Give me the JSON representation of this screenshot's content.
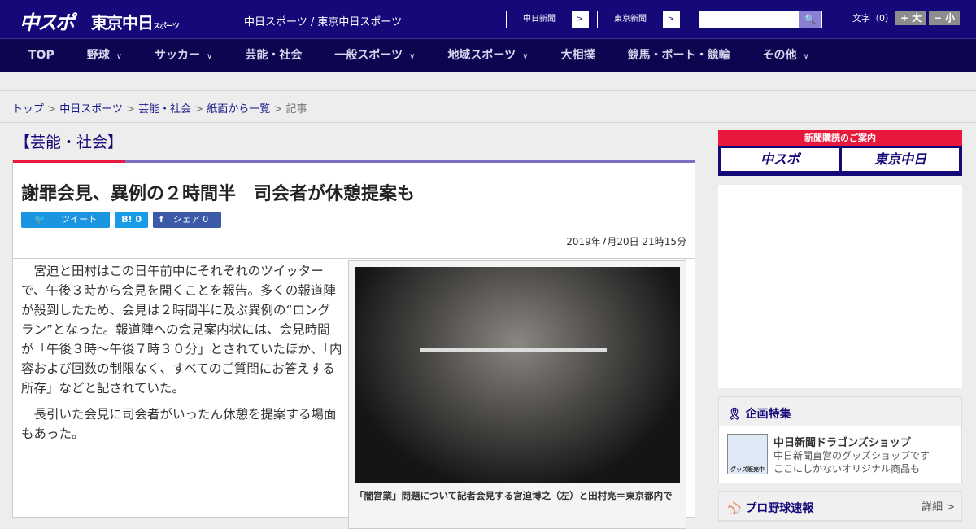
{
  "header": {
    "logo_main": "中スポ",
    "logo_tokyo": "東京中日",
    "logo_tokyo_small": "スポーツ",
    "tagline": "中日スポーツ / 東京中日スポーツ",
    "paper1": "中日新聞",
    "paper2": "東京新聞",
    "arrow": ">",
    "search_icon": "🔍",
    "font_size_label": "文字（0）",
    "font_up": "+ 大",
    "font_down": "− 小"
  },
  "nav": [
    {
      "label": "TOP",
      "caret": ""
    },
    {
      "label": "野球",
      "caret": "∨"
    },
    {
      "label": "サッカー",
      "caret": "∨"
    },
    {
      "label": "芸能・社会",
      "caret": ""
    },
    {
      "label": "一般スポーツ",
      "caret": "∨"
    },
    {
      "label": "地域スポーツ",
      "caret": "∨"
    },
    {
      "label": "大相撲",
      "caret": ""
    },
    {
      "label": "競馬・ボート・競輪",
      "caret": ""
    },
    {
      "label": "その他",
      "caret": "∨"
    }
  ],
  "breadcrumb": {
    "items": [
      "トップ",
      "中日スポーツ",
      "芸能・社会",
      "紙面から一覧"
    ],
    "current": "記事",
    "sep": " > "
  },
  "category": "【芸能・社会】",
  "article": {
    "title": "謝罪会見、異例の２時間半　司会者が休憩提案も",
    "tweet": "ツイート",
    "hatena": "B! 0",
    "share": "シェア 0",
    "date": "2019年7月20日 21時15分",
    "paragraphs": [
      "宮迫と田村はこの日午前中にそれぞれのツイッターで、午後３時から会見を開くことを報告。多くの報道陣が殺到したため、会見は２時間半に及ぶ異例の“ロングラン”となった。報道陣への会見案内状には、会見時間が「午後３時～午後７時３０分」とされていたほか、「内容および回数の制限なく、すべてのご質問にお答えする所存」などと記されていた。",
      "長引いた会見に司会者がいったん休憩を提案する場面もあった。"
    ],
    "caption": "「闇営業」問題について記者会見する宮迫博之（左）と田村亮＝東京都内で"
  },
  "sidebar": {
    "subscribe_title": "新聞購読のご案内",
    "subscribe_1": "中スポ",
    "subscribe_2": "東京中日",
    "feature_title": "企画特集",
    "shop_title": "中日新聞ドラゴンズショップ",
    "shop_line1": "中日新聞直営のグッズショップです",
    "shop_line2": "ここにしかないオリジナル商品も",
    "shop_badge": "グッズ販売中",
    "baseball_title": "プロ野球速報",
    "detail": "詳細 >"
  },
  "colors": {
    "header": "#150878",
    "nav": "#0d0550",
    "accent_red": "#e8173c",
    "accent_purple": "#7a6fc0"
  }
}
